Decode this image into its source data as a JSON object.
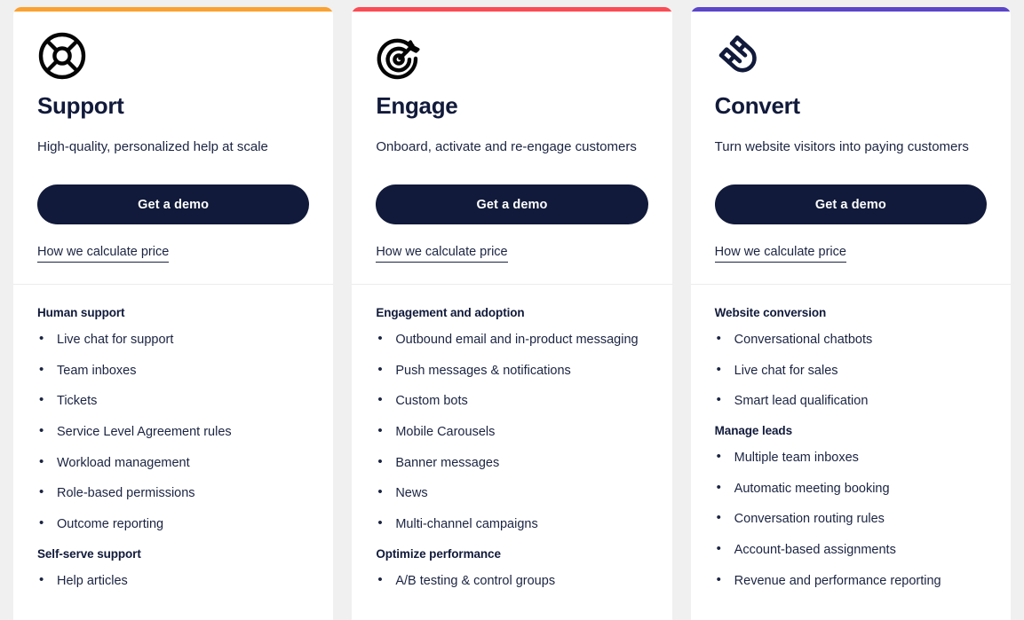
{
  "page": {
    "background_color": "#f0f0f0",
    "card_background": "#ffffff",
    "text_color": "#1b2442",
    "heading_color": "#111a3a"
  },
  "cards": [
    {
      "accent_color": "#faa131",
      "icon": "lifebuoy-icon",
      "title": "Support",
      "tagline": "High-quality, personalized help at scale",
      "cta_label": "Get a demo",
      "price_link_label": "How we calculate price",
      "groups": [
        {
          "title": "Human support",
          "items": [
            "Live chat for support",
            "Team inboxes",
            "Tickets",
            "Service Level Agreement rules",
            "Workload management",
            "Role-based permissions",
            "Outcome reporting"
          ]
        },
        {
          "title": "Self-serve support",
          "items": [
            "Help articles"
          ]
        }
      ]
    },
    {
      "accent_color": "#fb4b54",
      "icon": "target-dart-icon",
      "title": "Engage",
      "tagline": "Onboard, activate and re-engage customers",
      "cta_label": "Get a demo",
      "price_link_label": "How we calculate price",
      "groups": [
        {
          "title": "Engagement and adoption",
          "items": [
            "Outbound email and in-product messaging",
            "Push messages & notifications",
            "Custom bots",
            "Mobile Carousels",
            "Banner messages",
            "News",
            "Multi-channel campaigns"
          ]
        },
        {
          "title": "Optimize performance",
          "items": [
            "A/B testing & control groups"
          ]
        }
      ]
    },
    {
      "accent_color": "#5b46c9",
      "icon": "magnet-icon",
      "title": "Convert",
      "tagline": "Turn website visitors into paying customers",
      "cta_label": "Get a demo",
      "price_link_label": "How we calculate price",
      "groups": [
        {
          "title": "Website conversion",
          "items": [
            "Conversational chatbots",
            "Live chat for sales",
            "Smart lead qualification"
          ]
        },
        {
          "title": "Manage leads",
          "items": [
            "Multiple team inboxes",
            "Automatic meeting booking",
            "Conversation routing rules",
            "Account-based assignments",
            "Revenue and performance reporting"
          ]
        }
      ]
    }
  ]
}
